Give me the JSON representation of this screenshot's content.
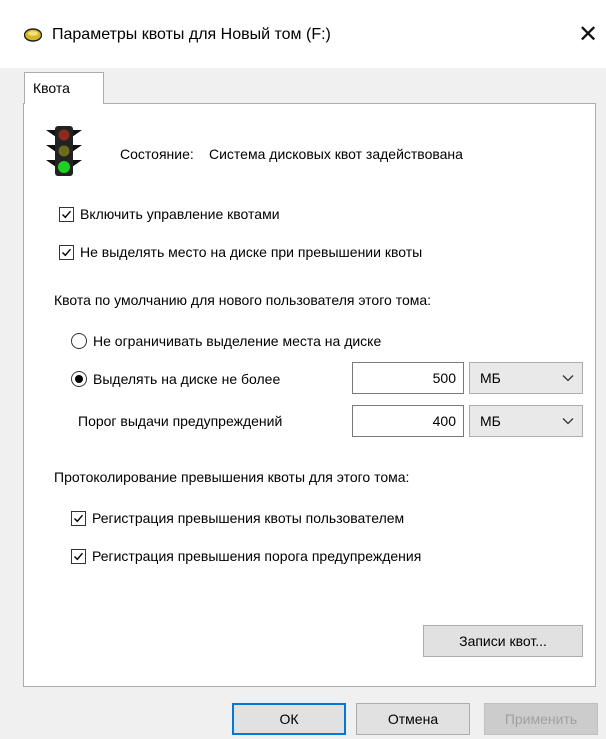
{
  "window": {
    "title": "Параметры квоты для Новый том (F:)",
    "close_glyph": "✕"
  },
  "tabs": [
    {
      "label": "Квота",
      "active": true
    }
  ],
  "status": {
    "label": "Состояние:",
    "value": "Система дисковых квот задействована",
    "icon": "traffic-light-icon"
  },
  "options": {
    "enable_quota": {
      "label": "Включить управление квотами",
      "checked": true
    },
    "deny_space": {
      "label": "Не выделять место на диске при превышении квоты",
      "checked": true
    }
  },
  "default_quota": {
    "heading": "Квота по умолчанию для нового пользователя этого тома:",
    "no_limit": {
      "label": "Не ограничивать выделение места на диске",
      "selected": false
    },
    "limit": {
      "label": "Выделять на диске не более",
      "selected": true,
      "value": "500",
      "unit": "МБ"
    },
    "warning": {
      "label": "Порог выдачи предупреждений",
      "value": "400",
      "unit": "МБ"
    }
  },
  "logging": {
    "heading": "Протоколирование превышения квоты для этого тома:",
    "log_limit": {
      "label": "Регистрация превышения квоты пользователем",
      "checked": true
    },
    "log_warning": {
      "label": "Регистрация превышения порога предупреждения",
      "checked": true
    }
  },
  "buttons": {
    "entries": "Записи квот...",
    "ok": "ОК",
    "cancel": "Отмена",
    "apply": "Применить"
  },
  "colors": {
    "accent": "#0078d7",
    "light_red": "#c0392b",
    "light_green": "#1fd11f"
  }
}
